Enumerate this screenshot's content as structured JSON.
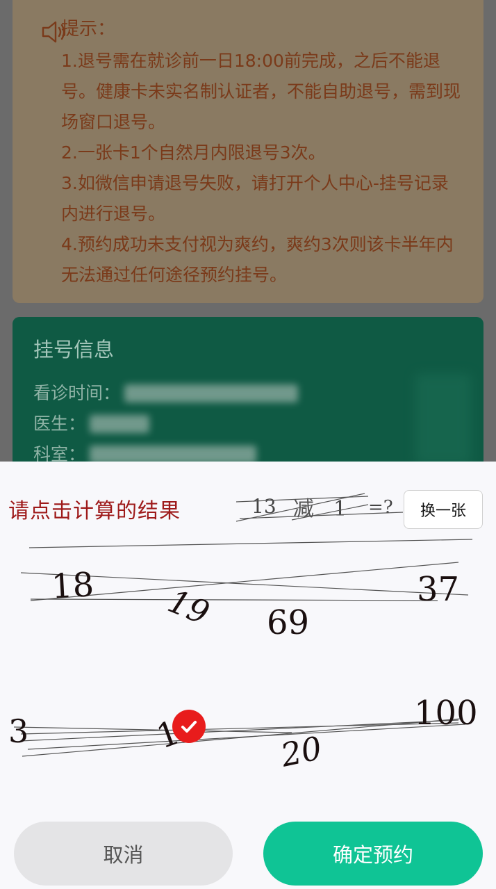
{
  "notice": {
    "title": "提示：",
    "items": [
      "1.退号需在就诊前一日18:00前完成，之后不能退号。健康卡未实名制认证者，不能自助退号，需到现场窗口退号。",
      "2.一张卡1个自然月内限退号3次。",
      "3.如微信申请退号失败，请打开个人中心-挂号记录内进行退号。",
      "4.预约成功未支付视为爽约，爽约3次则该卡半年内无法通过任何途径预约挂号。"
    ]
  },
  "registration": {
    "title": "挂号信息",
    "time_label": "看诊时间：",
    "doctor_label": "医生：",
    "dept_label": "科室："
  },
  "captcha": {
    "prompt": "请点击计算的结果",
    "question": [
      "13",
      "减",
      "1",
      "=?"
    ],
    "refresh_label": "换一张",
    "options": [
      "18",
      "37",
      "19",
      "69",
      "3",
      "1",
      "20",
      "100"
    ]
  },
  "actions": {
    "cancel": "取消",
    "confirm": "确定预约"
  },
  "colors": {
    "confirm": "#0fc495",
    "prompt": "#9e1a1a",
    "selected": "#e81c1c"
  }
}
